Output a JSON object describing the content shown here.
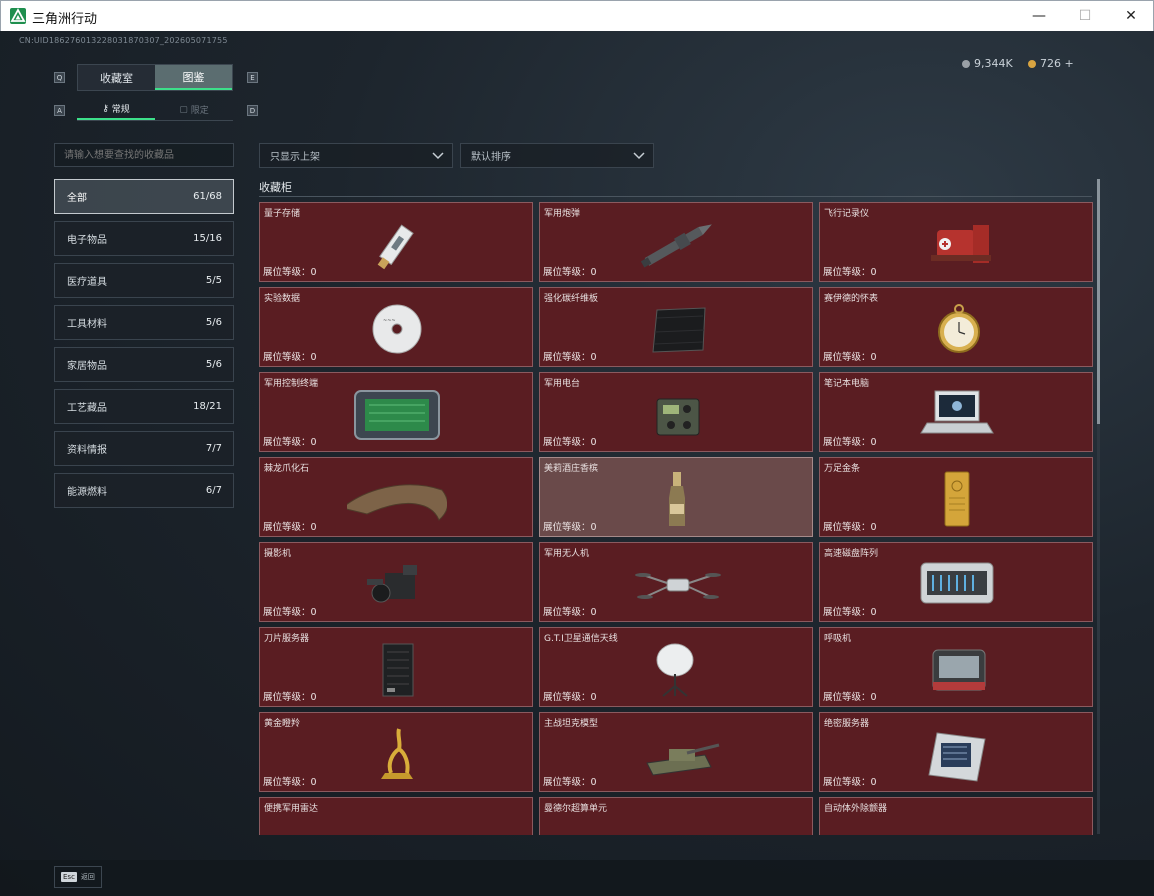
{
  "window": {
    "title": "三角洲行动",
    "minimize": "—",
    "maximize": "☐",
    "close": "✕"
  },
  "header": {
    "uid": "CN:UID18627601322803187030​7_202605071755",
    "currency_a": "9,344K",
    "currency_b": "726 +",
    "currency_a_color": "#9aa0a6",
    "currency_b_color": "#d9a441"
  },
  "keys": {
    "q": "Q",
    "e": "E",
    "a": "A",
    "d": "D"
  },
  "tabs": [
    {
      "label": "收藏室",
      "active": false
    },
    {
      "label": "图鉴",
      "active": true
    }
  ],
  "subtabs": [
    {
      "label": "常规",
      "icon": "key-icon",
      "active": true
    },
    {
      "label": "限定",
      "icon": "box-icon",
      "active": false
    }
  ],
  "search": {
    "placeholder": "请输入想要查找的收藏品"
  },
  "filters": {
    "display": "只显示上架",
    "sort": "默认排序"
  },
  "categories": [
    {
      "label": "全部",
      "count": "61/68",
      "active": true
    },
    {
      "label": "电子物品",
      "count": "15/16"
    },
    {
      "label": "医疗道具",
      "count": "5/5"
    },
    {
      "label": "工具材料",
      "count": "5/6"
    },
    {
      "label": "家居物品",
      "count": "5/6"
    },
    {
      "label": "工艺藏品",
      "count": "18/21"
    },
    {
      "label": "资料情报",
      "count": "7/7"
    },
    {
      "label": "能源燃料",
      "count": "6/7"
    }
  ],
  "section": {
    "title": "收藏柜"
  },
  "level_label": "展位等级：0",
  "items": [
    {
      "name": "量子存储",
      "icon": "usb-drive-icon"
    },
    {
      "name": "军用炮弹",
      "icon": "shell-icon"
    },
    {
      "name": "飞行记录仪",
      "icon": "flight-recorder-icon"
    },
    {
      "name": "实验数据",
      "icon": "disc-icon"
    },
    {
      "name": "强化碳纤维板",
      "icon": "carbon-plate-icon"
    },
    {
      "name": "赛伊德的怀表",
      "icon": "pocket-watch-icon"
    },
    {
      "name": "军用控制终端",
      "icon": "control-terminal-icon"
    },
    {
      "name": "军用电台",
      "icon": "radio-icon"
    },
    {
      "name": "笔记本电脑",
      "icon": "laptop-icon"
    },
    {
      "name": "棘龙爪化石",
      "icon": "claw-fossil-icon"
    },
    {
      "name": "美莉酒庄香槟",
      "icon": "champagne-icon",
      "highlight": true
    },
    {
      "name": "万足金条",
      "icon": "gold-bar-icon"
    },
    {
      "name": "摄影机",
      "icon": "camera-icon"
    },
    {
      "name": "军用无人机",
      "icon": "drone-icon"
    },
    {
      "name": "高速磁盘阵列",
      "icon": "disk-array-icon"
    },
    {
      "name": "刀片服务器",
      "icon": "blade-server-icon"
    },
    {
      "name": "G.T.I卫星通信天线",
      "icon": "satellite-dish-icon"
    },
    {
      "name": "呼吸机",
      "icon": "ventilator-icon"
    },
    {
      "name": "黄金瞪羚",
      "icon": "gold-gazelle-icon"
    },
    {
      "name": "主战坦克模型",
      "icon": "tank-model-icon"
    },
    {
      "name": "绝密服务器",
      "icon": "secret-server-icon"
    },
    {
      "name": "便携军用雷达",
      "icon": "radar-icon"
    },
    {
      "name": "曼德尔超算单元",
      "icon": "compute-unit-icon"
    },
    {
      "name": "自动体外除颤器",
      "icon": "defibrillator-icon"
    }
  ],
  "footer": {
    "esc_key": "Esc",
    "esc_label": "返回"
  }
}
